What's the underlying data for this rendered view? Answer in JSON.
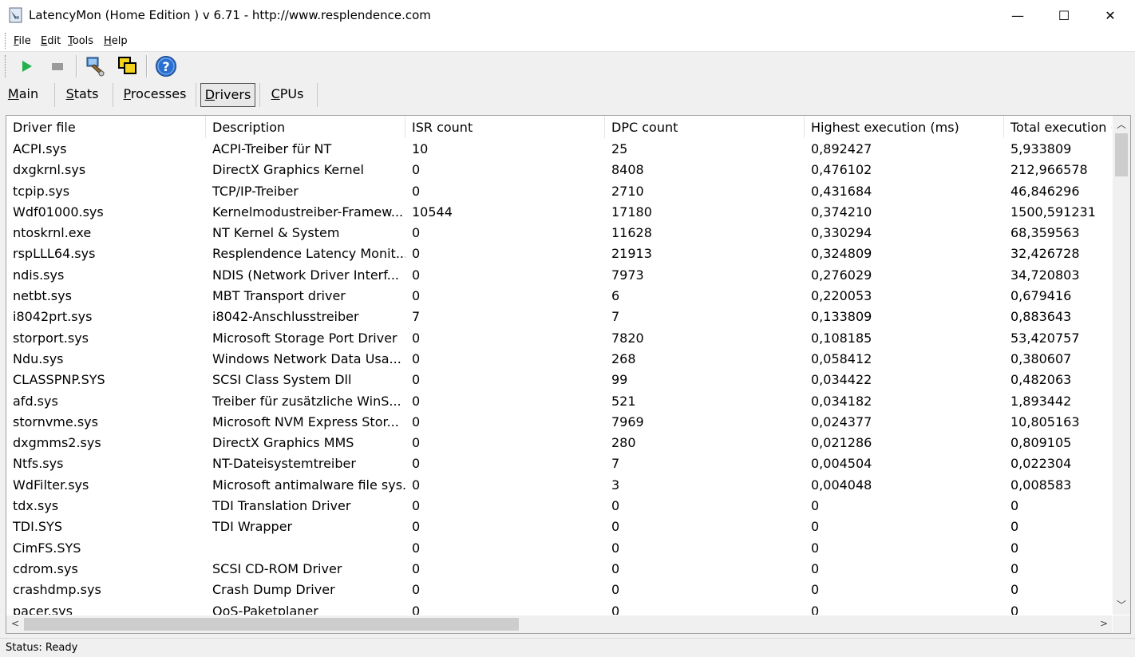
{
  "window": {
    "title": "LatencyMon  (Home Edition )  v 6.71 - http://www.resplendence.com",
    "minimize_glyph": "—",
    "maximize_glyph": "☐",
    "close_glyph": "✕"
  },
  "menu": [
    {
      "u": "F",
      "rest": "ile"
    },
    {
      "u": "E",
      "rest": "dit"
    },
    {
      "u": "T",
      "rest": "ools"
    },
    {
      "u": "H",
      "rest": "elp"
    }
  ],
  "toolbar": {
    "icons": [
      "play-icon",
      "stop-icon",
      "inspect-icon",
      "windows-icon",
      "help-icon"
    ],
    "play_color": "#22b14c",
    "help_color": "#2a6fd1"
  },
  "tabs": [
    {
      "u": "M",
      "rest": "ain",
      "active": false
    },
    {
      "u": "S",
      "rest": "tats",
      "active": false
    },
    {
      "u": "P",
      "rest": "rocesses",
      "active": false
    },
    {
      "u": "D",
      "rest": "rivers",
      "active": true
    },
    {
      "u": "C",
      "rest": "PUs",
      "active": false
    }
  ],
  "table": {
    "columns": [
      "Driver file",
      "Description",
      "ISR count",
      "DPC count",
      "Highest execution (ms)",
      "Total execution (ms)"
    ],
    "rows": [
      [
        "ACPI.sys",
        "ACPI-Treiber für NT",
        "10",
        "25",
        "0,892427",
        "5,933809"
      ],
      [
        "dxgkrnl.sys",
        "DirectX Graphics Kernel",
        "0",
        "8408",
        "0,476102",
        "212,966578"
      ],
      [
        "tcpip.sys",
        "TCP/IP-Treiber",
        "0",
        "2710",
        "0,431684",
        "46,846296"
      ],
      [
        "Wdf01000.sys",
        "Kernelmodustreiber-Framew...",
        "10544",
        "17180",
        "0,374210",
        "1500,591231"
      ],
      [
        "ntoskrnl.exe",
        "NT Kernel & System",
        "0",
        "11628",
        "0,330294",
        "68,359563"
      ],
      [
        "rspLLL64.sys",
        "Resplendence Latency Monit...",
        "0",
        "21913",
        "0,324809",
        "32,426728"
      ],
      [
        "ndis.sys",
        "NDIS (Network Driver Interf...",
        "0",
        "7973",
        "0,276029",
        "34,720803"
      ],
      [
        "netbt.sys",
        "MBT Transport driver",
        "0",
        "6",
        "0,220053",
        "0,679416"
      ],
      [
        "i8042prt.sys",
        "i8042-Anschlusstreiber",
        "7",
        "7",
        "0,133809",
        "0,883643"
      ],
      [
        "storport.sys",
        "Microsoft Storage Port Driver",
        "0",
        "7820",
        "0,108185",
        "53,420757"
      ],
      [
        "Ndu.sys",
        "Windows Network Data Usa...",
        "0",
        "268",
        "0,058412",
        "0,380607"
      ],
      [
        "CLASSPNP.SYS",
        "SCSI Class System Dll",
        "0",
        "99",
        "0,034422",
        "0,482063"
      ],
      [
        "afd.sys",
        "Treiber für zusätzliche WinS...",
        "0",
        "521",
        "0,034182",
        "1,893442"
      ],
      [
        "stornvme.sys",
        "Microsoft NVM Express Stor...",
        "0",
        "7969",
        "0,024377",
        "10,805163"
      ],
      [
        "dxgmms2.sys",
        "DirectX Graphics MMS",
        "0",
        "280",
        "0,021286",
        "0,809105"
      ],
      [
        "Ntfs.sys",
        "NT-Dateisystemtreiber",
        "0",
        "7",
        "0,004504",
        "0,022304"
      ],
      [
        "WdFilter.sys",
        "Microsoft antimalware file sys...",
        "0",
        "3",
        "0,004048",
        "0,008583"
      ],
      [
        "tdx.sys",
        "TDI Translation Driver",
        "0",
        "0",
        "0",
        "0"
      ],
      [
        "TDI.SYS",
        "TDI Wrapper",
        "0",
        "0",
        "0",
        "0"
      ],
      [
        "CimFS.SYS",
        "",
        "0",
        "0",
        "0",
        "0"
      ],
      [
        "cdrom.sys",
        "SCSI CD-ROM Driver",
        "0",
        "0",
        "0",
        "0"
      ],
      [
        "crashdmp.sys",
        "Crash Dump Driver",
        "0",
        "0",
        "0",
        "0"
      ],
      [
        "pacer.sys",
        "QoS-Paketplaner",
        "0",
        "0",
        "0",
        "0"
      ]
    ]
  },
  "status": {
    "text": "Status: Ready"
  }
}
